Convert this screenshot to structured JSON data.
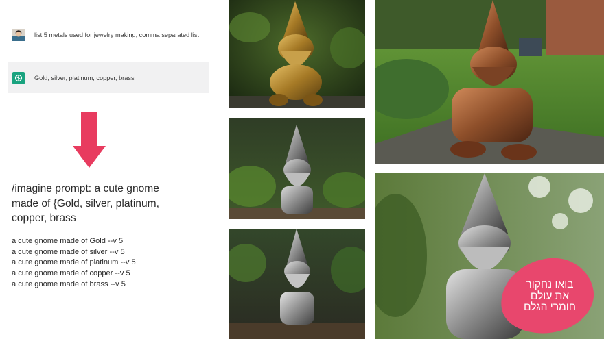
{
  "chat": {
    "user_message": "list 5 metals used for jewelry making, comma separated list",
    "assistant_message": "Gold, silver, platinum, copper, brass"
  },
  "prompt_text": "/imagine prompt: a cute gnome made of {Gold, silver, platinum, copper, brass",
  "variants": [
    "a cute gnome made of Gold --v 5",
    "a cute gnome made of silver --v 5",
    "a cute gnome made of platinum --v 5",
    "a cute gnome made of copper --v 5",
    "a cute gnome made of brass --v 5"
  ],
  "badge": {
    "line1": "בואו נחקור",
    "line2": "את עולם",
    "line3": "חומרי הגלם"
  },
  "colors": {
    "arrow": "#e83b5f",
    "badge": "#e8476d",
    "chat_bubble": "#f1f1f2",
    "assistant_icon": "#19a37f"
  },
  "images": [
    {
      "metal": "gold"
    },
    {
      "metal": "silver"
    },
    {
      "metal": "platinum"
    },
    {
      "metal": "copper"
    },
    {
      "metal": "silver"
    }
  ]
}
